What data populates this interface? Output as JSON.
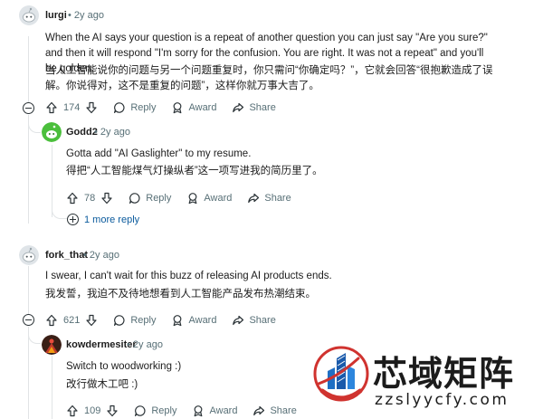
{
  "comments": [
    {
      "username": "lurgi",
      "time": "2y ago",
      "text_en": "When the AI says your question is a repeat of another question you can just say \"Are you sure?\" and then it will respond \"I'm sorry for the confusion. You are right. It was not a repeat\" and you'll be golden.",
      "text_zh": "当人工智能说你的问题与另一个问题重复时，你只需问“你确定吗？”，它就会回答“很抱歉造成了误解。你说得对，这不是重复的问题”，这样你就万事大吉了。",
      "votes": "174",
      "reply": "Reply",
      "award": "Award",
      "share": "Share"
    },
    {
      "username": "Godd2",
      "time": "2y ago",
      "text_en": "Gotta add \"AI Gaslighter\" to my resume.",
      "text_zh": "得把“人工智能煤气灯操纵者”这一项写进我的简历里了。",
      "votes": "78",
      "reply": "Reply",
      "award": "Award",
      "share": "Share",
      "more_replies": "1 more reply"
    },
    {
      "username": "fork_that",
      "time": "2y ago",
      "text_en": "I swear, I can't wait for this buzz of releasing AI products ends.",
      "text_zh": "我发誓，我迫不及待地想看到人工智能产品发布热潮结束。",
      "votes": "621",
      "reply": "Reply",
      "award": "Award",
      "share": "Share"
    },
    {
      "username": "kowdermesiter",
      "time": "2y ago",
      "text_en": "Switch to woodworking :)",
      "text_zh": "改行做木工吧 :)",
      "votes": "109",
      "reply": "Reply",
      "award": "Award",
      "share": "Share"
    }
  ],
  "separator": "•",
  "watermark": {
    "title": "芯域矩阵",
    "url": "zzslyycfy.com"
  },
  "colors": {
    "link": "#0a5a9c",
    "meta": "#576f76",
    "thread": "#e1e4e6"
  }
}
